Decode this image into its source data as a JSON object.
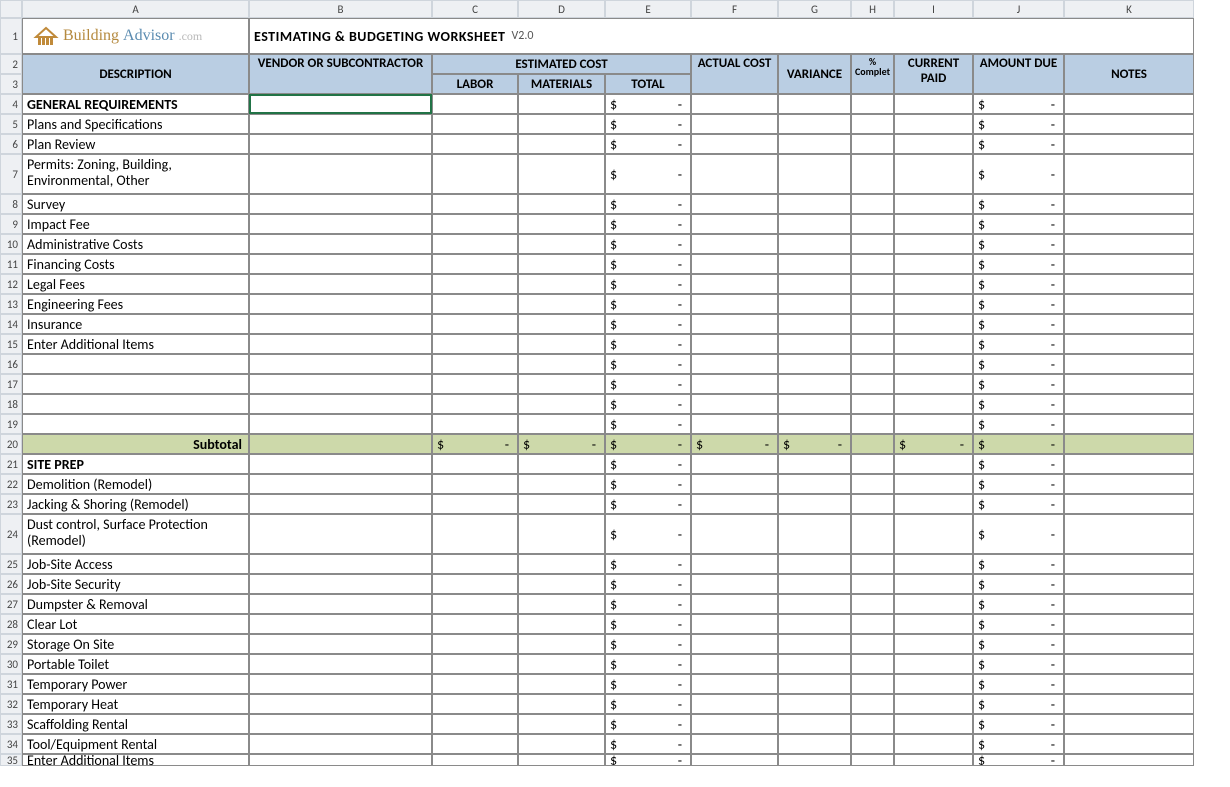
{
  "columns": [
    "A",
    "B",
    "C",
    "D",
    "E",
    "F",
    "G",
    "H",
    "I",
    "J",
    "K"
  ],
  "title": "ESTIMATING & BUDGETING WORKSHEET",
  "version": "V2.0",
  "logo": {
    "part1": "Building",
    "part2": "Advisor",
    "part3": ".com"
  },
  "headers": {
    "description": "DESCRIPTION",
    "vendor": "VENDOR   OR SUBCONTRACTOR",
    "estcost": "ESTIMATED COST",
    "labor": "LABOR",
    "materials": "MATERIALS",
    "total": "TOTAL",
    "actual": "ACTUAL COST",
    "variance": "VARIANCE",
    "pct": "% Complet",
    "paid": "CURRENT PAID",
    "due": "AMOUNT DUE",
    "notes": "NOTES"
  },
  "currency_sym": "$",
  "dash": "-",
  "subtotal_label": "Subtotal",
  "rows": [
    {
      "n": 4,
      "desc": "GENERAL REQUIREMENTS",
      "bold": true,
      "tall": false,
      "selectedB": true
    },
    {
      "n": 5,
      "desc": "Plans and Specifications"
    },
    {
      "n": 6,
      "desc": "Plan Review"
    },
    {
      "n": 7,
      "desc": "Permits: Zoning, Building, Environmental, Other",
      "tall": true
    },
    {
      "n": 8,
      "desc": "Survey"
    },
    {
      "n": 9,
      "desc": "Impact Fee"
    },
    {
      "n": 10,
      "desc": "Administrative Costs"
    },
    {
      "n": 11,
      "desc": "Financing Costs"
    },
    {
      "n": 12,
      "desc": "Legal Fees"
    },
    {
      "n": 13,
      "desc": "Engineering Fees"
    },
    {
      "n": 14,
      "desc": "Insurance"
    },
    {
      "n": 15,
      "desc": "Enter Additional Items"
    },
    {
      "n": 16,
      "desc": ""
    },
    {
      "n": 17,
      "desc": ""
    },
    {
      "n": 18,
      "desc": ""
    },
    {
      "n": 19,
      "desc": ""
    },
    {
      "n": 20,
      "subtotal": true
    },
    {
      "n": 21,
      "desc": "SITE PREP",
      "bold": true
    },
    {
      "n": 22,
      "desc": "Demolition (Remodel)"
    },
    {
      "n": 23,
      "desc": "Jacking & Shoring (Remodel)"
    },
    {
      "n": 24,
      "desc": "Dust control, Surface Protection (Remodel)",
      "tall": true
    },
    {
      "n": 25,
      "desc": "Job-Site Access"
    },
    {
      "n": 26,
      "desc": "Job-Site Security"
    },
    {
      "n": 27,
      "desc": "Dumpster & Removal"
    },
    {
      "n": 28,
      "desc": "Clear Lot"
    },
    {
      "n": 29,
      "desc": "Storage On Site"
    },
    {
      "n": 30,
      "desc": "Portable Toilet"
    },
    {
      "n": 31,
      "desc": "Temporary Power"
    },
    {
      "n": 32,
      "desc": "Temporary Heat"
    },
    {
      "n": 33,
      "desc": "Scaffolding Rental"
    },
    {
      "n": 34,
      "desc": "Tool/Equipment Rental"
    },
    {
      "n": 35,
      "desc": "Enter Additional Items",
      "partial": true
    }
  ]
}
